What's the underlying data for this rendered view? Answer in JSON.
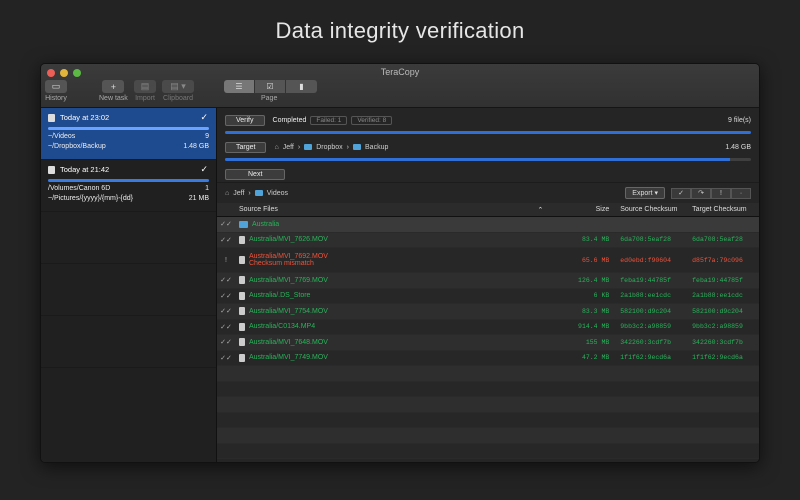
{
  "headline": "Data integrity verification",
  "window": {
    "title": "TeraCopy"
  },
  "toolbar": {
    "history": "History",
    "new_task": "New task",
    "import": "Import",
    "clipboard": "Clipboard",
    "page": "Page"
  },
  "sidebar": {
    "tasks": [
      {
        "title": "Today at 23:02",
        "row1_path": "~/Videos",
        "row1_val": "9",
        "row2_path": "~/Dropbox/Backup",
        "row2_val": "1.48 GB"
      },
      {
        "title": "Today at 21:42",
        "row1_path": "/Volumes/Canon 6D",
        "row1_val": "1",
        "row2_path": "~/Pictures/{yyyy}/{mm}-{dd}",
        "row2_val": "21 MB"
      }
    ]
  },
  "controls": {
    "verify": "Verify",
    "completed": "Completed",
    "failed": "Failed: 1",
    "verified": "Verified: 8",
    "files": "9 file(s)",
    "verify_progress": 1.0,
    "target": "Target",
    "target_path": [
      "Jeff",
      "Dropbox",
      "Backup"
    ],
    "target_size": "1.48 GB",
    "target_progress": 0.96,
    "next": "Next"
  },
  "filebar": {
    "path": [
      "Jeff",
      "Videos"
    ],
    "export": "Export"
  },
  "table": {
    "headers": {
      "source": "Source Files",
      "size": "Size",
      "src_ck": "Source Checksum",
      "tgt_ck": "Target Checksum"
    },
    "rows": [
      {
        "status": "✓✓",
        "name": "Australia",
        "size": "",
        "src": "",
        "tgt": "",
        "folder": true
      },
      {
        "status": "✓✓",
        "name": "Australia/MVI_7626.MOV",
        "size": "83.4 MB",
        "src": "6da708:5eaf28",
        "tgt": "6da708:5eaf28"
      },
      {
        "status": "!",
        "name": "Australia/MVI_7692.MOV",
        "note": "Checksum mismatch",
        "size": "65.6 MB",
        "src": "ed0ebd:f90604",
        "tgt": "d85f7a:79c096",
        "error": true
      },
      {
        "status": "✓✓",
        "name": "Australia/MVI_7769.MOV",
        "size": "126.4 MB",
        "src": "feba19:44785f",
        "tgt": "feba19:44785f"
      },
      {
        "status": "✓✓",
        "name": "Australia/.DS_Store",
        "size": "6 KB",
        "src": "2a1b88:ee1cdc",
        "tgt": "2a1b88:ee1cdc"
      },
      {
        "status": "✓✓",
        "name": "Australia/MVI_7754.MOV",
        "size": "83.3 MB",
        "src": "582100:d9c204",
        "tgt": "582100:d9c204"
      },
      {
        "status": "✓✓",
        "name": "Australia/C0134.MP4",
        "size": "914.4 MB",
        "src": "9bb3c2:a98859",
        "tgt": "9bb3c2:a98859"
      },
      {
        "status": "✓✓",
        "name": "Australia/MVI_7648.MOV",
        "size": "155 MB",
        "src": "342260:3cdf7b",
        "tgt": "342260:3cdf7b"
      },
      {
        "status": "✓✓",
        "name": "Australia/MVI_7749.MOV",
        "size": "47.2 MB",
        "src": "1f1f62:9ecd6a",
        "tgt": "1f1f62:9ecd6a"
      }
    ]
  }
}
